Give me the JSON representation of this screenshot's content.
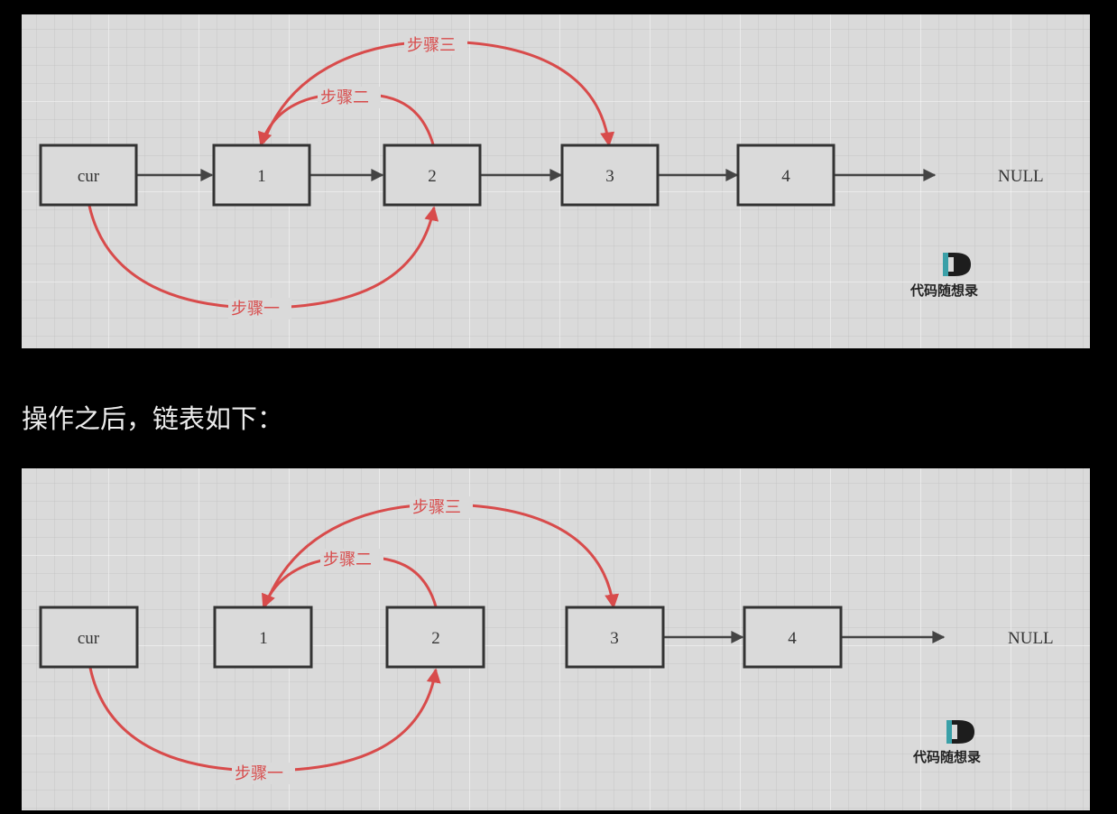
{
  "colors": {
    "page_background": "#000000",
    "panel_background": "#dadada",
    "node_border": "#333333",
    "arrow_dark": "#444444",
    "arrow_red": "#d84b4b",
    "caption_text": "#ececec",
    "logo_accent": "#3aa0a8"
  },
  "top_diagram": {
    "nodes": [
      "cur",
      "1",
      "2",
      "3",
      "4"
    ],
    "null_label": "NULL",
    "steps": {
      "step1": "步骤一",
      "step2": "步骤二",
      "step3": "步骤三"
    },
    "logo_text": "代码随想录"
  },
  "caption": "操作之后，链表如下：",
  "bottom_diagram": {
    "nodes": [
      "cur",
      "1",
      "2",
      "3",
      "4"
    ],
    "null_label": "NULL",
    "steps": {
      "step1": "步骤一",
      "step2": "步骤二",
      "step3": "步骤三"
    },
    "logo_text": "代码随想录"
  }
}
